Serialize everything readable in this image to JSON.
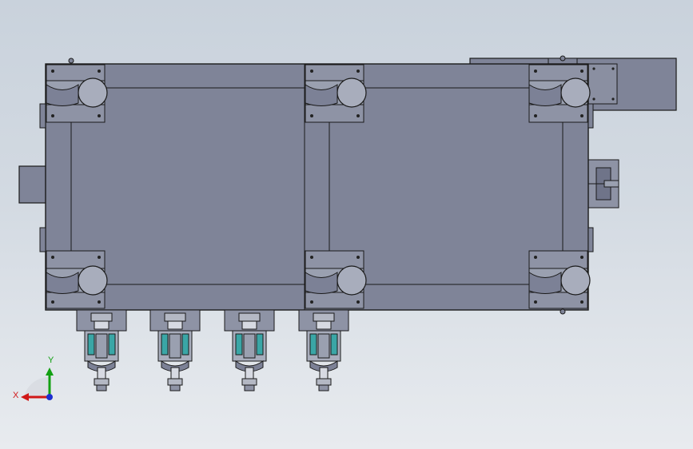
{
  "window": {
    "title": ""
  },
  "viewport": {
    "background_top": "#c9d2dc",
    "background_bottom": "#e8ebef",
    "body_color": "#7f8498",
    "edge_color": "#1a1a1a",
    "part_color": "#8e93a5",
    "cylinder_color": "#a8adbc",
    "spring_color": "#3aa6a6"
  },
  "triad": {
    "x_label": "X",
    "y_label": "Y",
    "x_color": "#d01818",
    "y_color": "#12a012",
    "z_color": "#1c2ed0"
  },
  "model": {
    "bearing_blocks": 6,
    "cylinder_units": 4
  }
}
